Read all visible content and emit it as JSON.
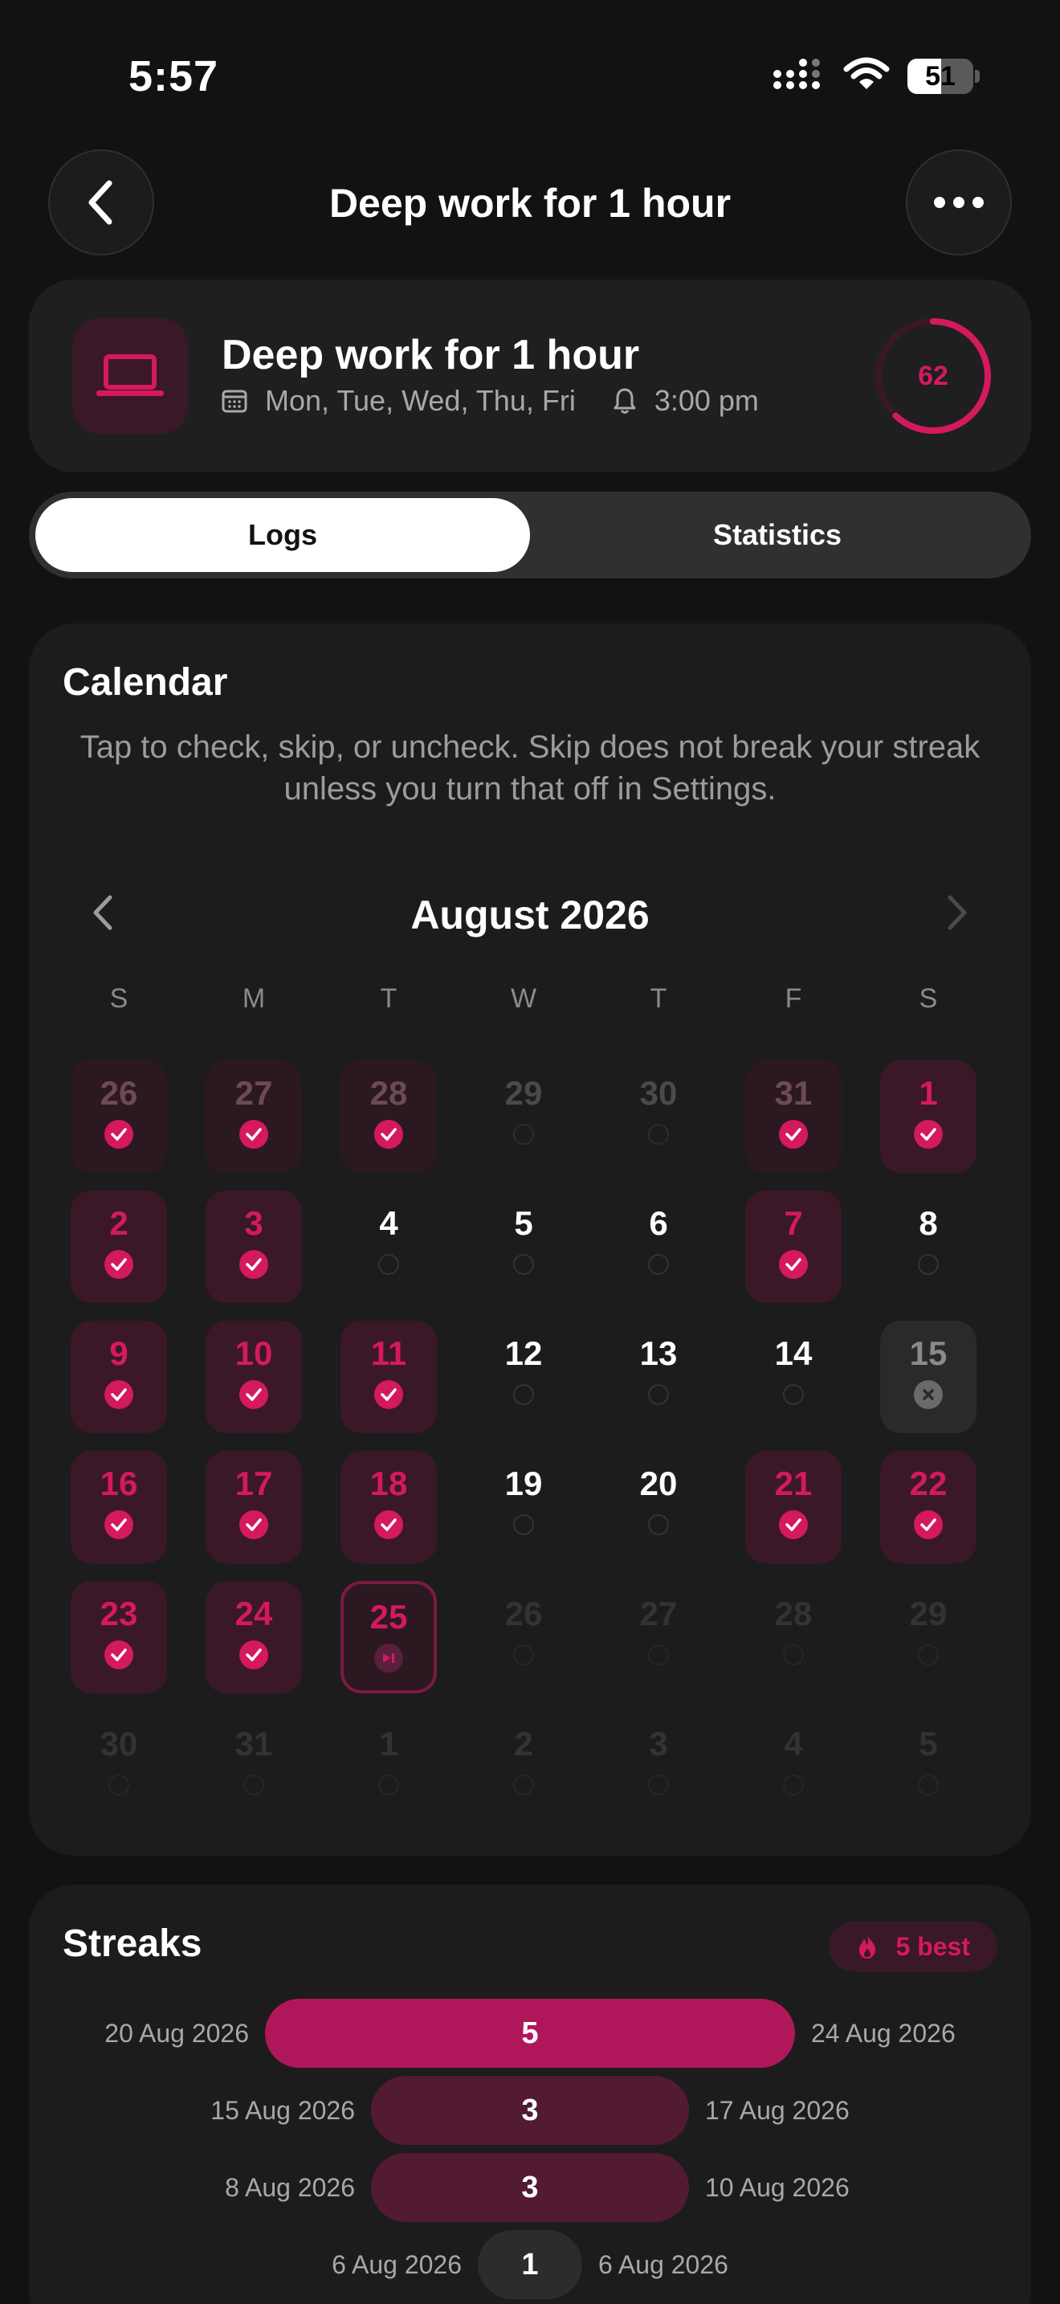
{
  "status": {
    "time": "5:57",
    "battery": "51",
    "battery_level": 0.51
  },
  "nav": {
    "title": "Deep work for 1 hour",
    "back_icon": "chevron-left-icon",
    "more_icon": "ellipsis-icon"
  },
  "habit": {
    "name": "Deep work for 1 hour",
    "icon": "laptop-icon",
    "days": "Mon, Tue, Wed, Thu, Fri",
    "reminder": "3:00 pm",
    "score": "62",
    "score_fraction": 0.62,
    "accent": "#d4195f"
  },
  "tabs": {
    "logs": "Logs",
    "statistics": "Statistics",
    "active": "logs"
  },
  "calendar": {
    "title": "Calendar",
    "description": "Tap to check, skip, or uncheck. Skip does not break your streak unless you turn that off in Settings.",
    "month": "August 2026",
    "weekdays": [
      "S",
      "M",
      "T",
      "W",
      "T",
      "F",
      "S"
    ],
    "days": [
      {
        "n": "26",
        "s": "faded-done"
      },
      {
        "n": "27",
        "s": "faded-done"
      },
      {
        "n": "28",
        "s": "faded-done"
      },
      {
        "n": "29",
        "s": "faded"
      },
      {
        "n": "30",
        "s": "faded"
      },
      {
        "n": "31",
        "s": "faded-done"
      },
      {
        "n": "1",
        "s": "done"
      },
      {
        "n": "2",
        "s": "done"
      },
      {
        "n": "3",
        "s": "done"
      },
      {
        "n": "4",
        "s": "open"
      },
      {
        "n": "5",
        "s": "open"
      },
      {
        "n": "6",
        "s": "open"
      },
      {
        "n": "7",
        "s": "done"
      },
      {
        "n": "8",
        "s": "open"
      },
      {
        "n": "9",
        "s": "done"
      },
      {
        "n": "10",
        "s": "done"
      },
      {
        "n": "11",
        "s": "done"
      },
      {
        "n": "12",
        "s": "open"
      },
      {
        "n": "13",
        "s": "open"
      },
      {
        "n": "14",
        "s": "open"
      },
      {
        "n": "15",
        "s": "skipped"
      },
      {
        "n": "16",
        "s": "done"
      },
      {
        "n": "17",
        "s": "done"
      },
      {
        "n": "18",
        "s": "done"
      },
      {
        "n": "19",
        "s": "open"
      },
      {
        "n": "20",
        "s": "open"
      },
      {
        "n": "21",
        "s": "done"
      },
      {
        "n": "22",
        "s": "done"
      },
      {
        "n": "23",
        "s": "done"
      },
      {
        "n": "24",
        "s": "done"
      },
      {
        "n": "25",
        "s": "today"
      },
      {
        "n": "26",
        "s": "dim"
      },
      {
        "n": "27",
        "s": "dim"
      },
      {
        "n": "28",
        "s": "dim"
      },
      {
        "n": "29",
        "s": "dim"
      },
      {
        "n": "30",
        "s": "dim"
      },
      {
        "n": "31",
        "s": "dim"
      },
      {
        "n": "1",
        "s": "dim"
      },
      {
        "n": "2",
        "s": "dim"
      },
      {
        "n": "3",
        "s": "dim"
      },
      {
        "n": "4",
        "s": "dim"
      },
      {
        "n": "5",
        "s": "dim"
      }
    ]
  },
  "streaks": {
    "title": "Streaks",
    "best_label": "5 best",
    "best_icon": "flame-icon",
    "items": [
      {
        "start": "20 Aug 2026",
        "end": "24 Aug 2026",
        "length": "5",
        "value": 5,
        "current": true
      },
      {
        "start": "15 Aug 2026",
        "end": "17 Aug 2026",
        "length": "3",
        "value": 3,
        "current": false
      },
      {
        "start": "8 Aug 2026",
        "end": "10 Aug 2026",
        "length": "3",
        "value": 3,
        "current": false
      },
      {
        "start": "6 Aug 2026",
        "end": "6 Aug 2026",
        "length": "1",
        "value": 1,
        "current": false
      }
    ]
  }
}
